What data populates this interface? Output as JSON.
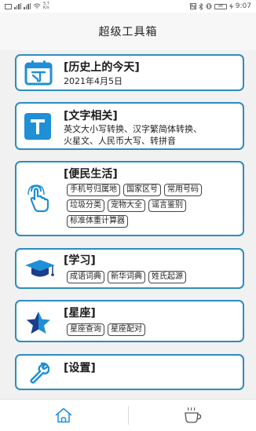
{
  "status_bar": {
    "left_text": "5.7 K/s",
    "right_text": "9:07",
    "battery": "98"
  },
  "header": {
    "title": "超级工具箱"
  },
  "cards": {
    "history": {
      "title": "[历史上的今天]",
      "date": "2021年4月5日"
    },
    "text": {
      "title": "[文字相关]",
      "line1": "英文大小写转换、汉字繁简体转换、",
      "line2": "火星文、人民币大写、转拼音",
      "icon_letter": "T"
    },
    "life": {
      "title": "[便民生活]",
      "tags": [
        "手机号归属地",
        "国家区号",
        "常用号码",
        "垃圾分类",
        "宠物大全",
        "谣言鉴别",
        "标准体重计算器"
      ]
    },
    "study": {
      "title": "[学习]",
      "tags": [
        "成语词典",
        "新华词典",
        "姓氏起源"
      ]
    },
    "zodiac": {
      "title": "[星座]",
      "tags": [
        "星座查询",
        "星座配对"
      ]
    },
    "settings": {
      "title": "[设置]"
    }
  },
  "icons": {
    "calendar": "calendar-icon",
    "text": "text-t-icon",
    "hand": "hand-tap-icon",
    "graduation": "graduation-cap-icon",
    "star": "star-icon",
    "wrench": "wrench-icon",
    "home": "home-icon",
    "coffee": "coffee-cup-icon"
  },
  "colors": {
    "card_border": "#2e8cc0",
    "icon_blue": "#1f8fd6",
    "icon_navy": "#1b3f8c"
  }
}
